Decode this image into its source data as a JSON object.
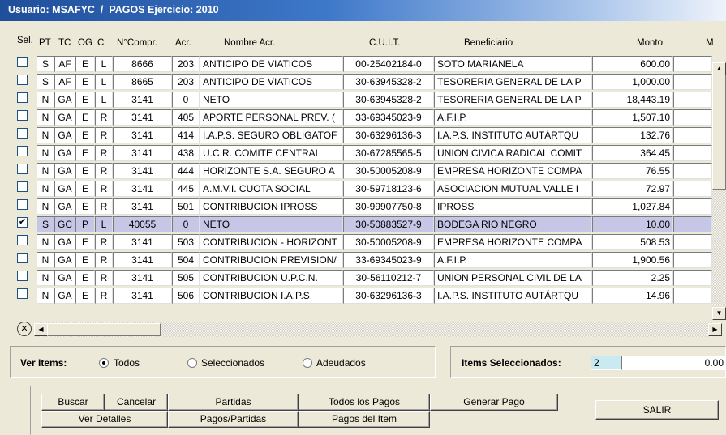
{
  "title": "Usuario: MSAFYC  /  PAGOS Ejercicio: 2010",
  "columns": [
    "Sel.",
    "PT",
    "TC",
    "OG",
    "C",
    "N°Compr.",
    "Acr.",
    "Nombre Acr.",
    "C.U.I.T.",
    "Beneficiario",
    "Monto",
    "M"
  ],
  "rows": [
    {
      "sel": false,
      "pt": "S",
      "tc": "AF",
      "og": "E",
      "c": "L",
      "compr": "8666",
      "acr": "203",
      "nombre": "ANTICIPO DE VIATICOS",
      "cuit": "00-25402184-0",
      "benef": "SOTO MARIANELA",
      "monto": "600.00"
    },
    {
      "sel": false,
      "pt": "S",
      "tc": "AF",
      "og": "E",
      "c": "L",
      "compr": "8665",
      "acr": "203",
      "nombre": "ANTICIPO DE VIATICOS",
      "cuit": "30-63945328-2",
      "benef": "TESORERIA GENERAL DE LA P",
      "monto": "1,000.00"
    },
    {
      "sel": false,
      "pt": "N",
      "tc": "GA",
      "og": "E",
      "c": "L",
      "compr": "3141",
      "acr": "0",
      "nombre": "NETO",
      "cuit": "30-63945328-2",
      "benef": "TESORERIA GENERAL DE LA P",
      "monto": "18,443.19"
    },
    {
      "sel": false,
      "pt": "N",
      "tc": "GA",
      "og": "E",
      "c": "R",
      "compr": "3141",
      "acr": "405",
      "nombre": "APORTE PERSONAL PREV. (",
      "cuit": "33-69345023-9",
      "benef": "A.F.I.P.",
      "monto": "1,507.10"
    },
    {
      "sel": false,
      "pt": "N",
      "tc": "GA",
      "og": "E",
      "c": "R",
      "compr": "3141",
      "acr": "414",
      "nombre": "I.A.P.S. SEGURO OBLIGATOF",
      "cuit": "30-63296136-3",
      "benef": "I.A.P.S. INSTITUTO AUTÁRTQU",
      "monto": "132.76"
    },
    {
      "sel": false,
      "pt": "N",
      "tc": "GA",
      "og": "E",
      "c": "R",
      "compr": "3141",
      "acr": "438",
      "nombre": "U.C.R. COMITE CENTRAL",
      "cuit": "30-67285565-5",
      "benef": "UNION CIVICA RADICAL COMIT",
      "monto": "364.45"
    },
    {
      "sel": false,
      "pt": "N",
      "tc": "GA",
      "og": "E",
      "c": "R",
      "compr": "3141",
      "acr": "444",
      "nombre": "HORIZONTE S.A. SEGURO A",
      "cuit": "30-50005208-9",
      "benef": "EMPRESA HORIZONTE COMPA",
      "monto": "76.55"
    },
    {
      "sel": false,
      "pt": "N",
      "tc": "GA",
      "og": "E",
      "c": "R",
      "compr": "3141",
      "acr": "445",
      "nombre": "A.M.V.I. CUOTA SOCIAL",
      "cuit": "30-59718123-6",
      "benef": "ASOCIACION MUTUAL VALLE I",
      "monto": "72.97"
    },
    {
      "sel": false,
      "pt": "N",
      "tc": "GA",
      "og": "E",
      "c": "R",
      "compr": "3141",
      "acr": "501",
      "nombre": "CONTRIBUCION IPROSS",
      "cuit": "30-99907750-8",
      "benef": "IPROSS",
      "monto": "1,027.84"
    },
    {
      "sel": true,
      "pt": "S",
      "tc": "GC",
      "og": "P",
      "c": "L",
      "compr": "40055",
      "acr": "0",
      "nombre": "NETO",
      "cuit": "30-50883527-9",
      "benef": " BODEGA RIO NEGRO",
      "monto": "10.00"
    },
    {
      "sel": false,
      "pt": "N",
      "tc": "GA",
      "og": "E",
      "c": "R",
      "compr": "3141",
      "acr": "503",
      "nombre": "CONTRIBUCION - HORIZONT",
      "cuit": "30-50005208-9",
      "benef": "EMPRESA HORIZONTE COMPA",
      "monto": "508.53"
    },
    {
      "sel": false,
      "pt": "N",
      "tc": "GA",
      "og": "E",
      "c": "R",
      "compr": "3141",
      "acr": "504",
      "nombre": "CONTRIBUCION PREVISION/",
      "cuit": "33-69345023-9",
      "benef": "A.F.I.P.",
      "monto": "1,900.56"
    },
    {
      "sel": false,
      "pt": "N",
      "tc": "GA",
      "og": "E",
      "c": "R",
      "compr": "3141",
      "acr": "505",
      "nombre": "CONTRIBUCION U.P.C.N.",
      "cuit": "30-56110212-7",
      "benef": "UNION PERSONAL CIVIL DE LA",
      "monto": "2.25"
    },
    {
      "sel": false,
      "pt": "N",
      "tc": "GA",
      "og": "E",
      "c": "R",
      "compr": "3141",
      "acr": "506",
      "nombre": "CONTRIBUCION I.A.P.S.",
      "cuit": "30-63296136-3",
      "benef": "I.A.P.S. INSTITUTO AUTÁRTQU",
      "monto": "14.96"
    }
  ],
  "filter": {
    "label": "Ver Items:",
    "options": [
      "Todos",
      "Seleccionados",
      "Adeudados"
    ],
    "selected": "Todos"
  },
  "selected_items": {
    "label": "Items Seleccionados:",
    "count": "2",
    "total": "0.00"
  },
  "buttons": {
    "buscar": "Buscar",
    "cancelar": "Cancelar",
    "partidas": "Partidas",
    "todos_pagos": "Todos los Pagos",
    "generar_pago": "Generar Pago",
    "ver_detalles": "Ver Detalles",
    "pagos_partidas": "Pagos/Partidas",
    "pagos_item": "Pagos del Item",
    "salir": "SALIR"
  },
  "icons": {
    "clear": "clear-filter-icon",
    "scroll_left": "arrow-left-icon",
    "scroll_right": "arrow-right-icon",
    "scroll_up": "arrow-up-icon",
    "scroll_down": "arrow-down-icon"
  }
}
